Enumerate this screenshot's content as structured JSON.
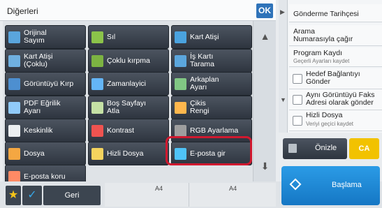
{
  "header": {
    "title": "Diğerleri",
    "ok_label": "OK"
  },
  "grid": [
    {
      "label": "Orijinal\nSayım",
      "icon": "original-count-icon"
    },
    {
      "label": "Sıl",
      "icon": "erase-icon"
    },
    {
      "label": "Kart Atişi",
      "icon": "card-shot-icon"
    },
    {
      "label": "Kart Atişi\n(Çoklu)",
      "icon": "card-shot-multi-icon"
    },
    {
      "label": "Çoklu kırpma",
      "icon": "multi-crop-icon"
    },
    {
      "label": "İş Kartı\nTarama",
      "icon": "business-card-scan-icon"
    },
    {
      "label": "Görüntüyü Kırp",
      "icon": "image-crop-icon"
    },
    {
      "label": "Zamanlayici",
      "icon": "timer-icon"
    },
    {
      "label": "Arkaplan\nAyarı",
      "icon": "background-adjust-icon"
    },
    {
      "label": "PDF Eğrilik\nAyarı",
      "icon": "pdf-skew-icon"
    },
    {
      "label": "Boş Sayfayı\nAtla",
      "icon": "skip-blank-page-icon"
    },
    {
      "label": "Çikis\nRengi",
      "icon": "output-color-icon"
    },
    {
      "label": "Keskinlik",
      "icon": "sharpness-icon"
    },
    {
      "label": "Kontrast",
      "icon": "contrast-icon"
    },
    {
      "label": "RGB Ayarlama",
      "icon": "rgb-adjust-icon"
    },
    {
      "label": "Dosya",
      "icon": "folder-icon"
    },
    {
      "label": "Hizli Dosya",
      "icon": "quick-file-icon"
    },
    {
      "label": "E-posta gir",
      "icon": "email-input-icon"
    },
    {
      "label": "E-posta koru",
      "icon": "email-protect-icon"
    }
  ],
  "bottom": {
    "back_label": "Geri",
    "paper_left": "A4",
    "paper_right": "A4"
  },
  "right_panel": {
    "history_label": "Gönderme Tarihçesi",
    "call_program": "Arama\nNumarasıyla çağır",
    "program_register": "Program Kaydı",
    "program_register_sub": "Geçerli Ayarları kaydet",
    "target_link": "Hedef Bağlantıyı\nGönder",
    "same_image": "Aynı Görüntüyü Faks\nAdresi olarak gönder",
    "quick_file": "Hizli Dosya",
    "quick_file_sub": "Veriyi geçici kaydet"
  },
  "actions": {
    "preview": "Önizle",
    "ca": "CA",
    "start": "Başlama"
  },
  "colors": {
    "accent": "#2f73b9",
    "highlight": "#d0192f",
    "ca_yellow": "#f2c200",
    "start_blue": "#1c86d8"
  }
}
